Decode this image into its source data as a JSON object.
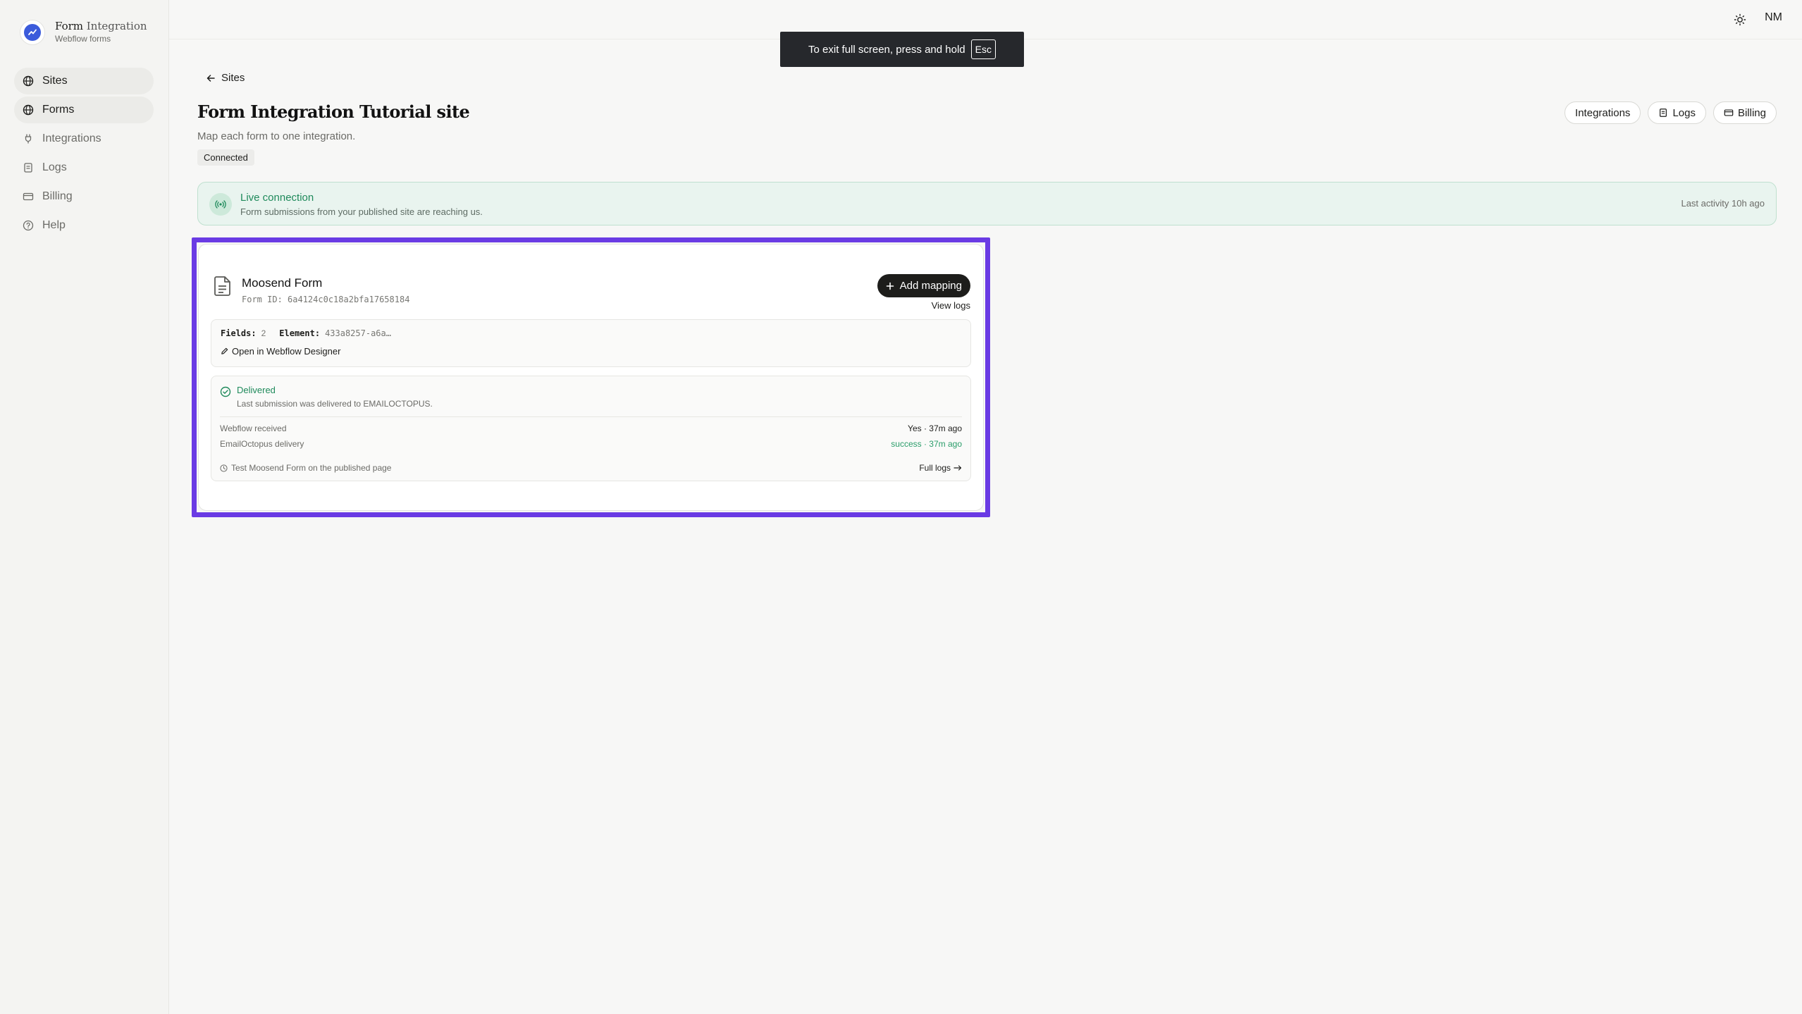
{
  "brand": {
    "title_main": "Form",
    "title_rest": "Integration",
    "subtitle": "Webflow forms"
  },
  "sidebar": {
    "items": [
      {
        "label": "Sites",
        "icon": "globe-icon",
        "active": true
      },
      {
        "label": "Forms",
        "icon": "globe-icon",
        "active": true
      },
      {
        "label": "Integrations",
        "icon": "plug-icon",
        "active": false
      },
      {
        "label": "Logs",
        "icon": "scroll-icon",
        "active": false
      },
      {
        "label": "Billing",
        "icon": "credit-card-icon",
        "active": false
      },
      {
        "label": "Help",
        "icon": "help-circle-icon",
        "active": false
      }
    ]
  },
  "topbar": {
    "avatar_initials": "NM",
    "theme_icon": "sun-icon"
  },
  "fullscreen_toast": {
    "text": "To exit full screen, press and hold",
    "key": "Esc"
  },
  "breadcrumb": {
    "back_label": "Sites"
  },
  "page": {
    "title": "Form Integration Tutorial site",
    "subtitle": "Map each form to one integration.",
    "status": "Connected"
  },
  "actions": {
    "integrations": "Integrations",
    "logs": "Logs",
    "billing": "Billing"
  },
  "live": {
    "title": "Live connection",
    "subtitle": "Form submissions from your published site are reaching us.",
    "last_activity": "Last activity 10h ago"
  },
  "form_card": {
    "name": "Moosend Form",
    "form_id": "Form ID: 6a4124c0c18a2bfa17658184",
    "add_mapping": "Add mapping",
    "view_logs": "View logs",
    "fields_key": "Fields:",
    "fields_value": "2",
    "element_key": "Element:",
    "element_value": "433a8257-a6a…",
    "open_designer": "Open in Webflow Designer",
    "delivered_title": "Delivered",
    "delivered_sub": "Last submission was delivered to EMAILOCTOPUS.",
    "rows": [
      {
        "label": "Webflow received",
        "value": "Yes · 37m ago",
        "tone": "normal"
      },
      {
        "label": "EmailOctopus delivery",
        "value": "success · 37m ago",
        "tone": "green"
      }
    ],
    "test_text": "Test Moosend Form on the published page",
    "full_logs": "Full logs"
  },
  "colors": {
    "accent_frame": "#6a3be4",
    "success": "#1f8a5b",
    "primary_button": "#1d1d1b"
  }
}
